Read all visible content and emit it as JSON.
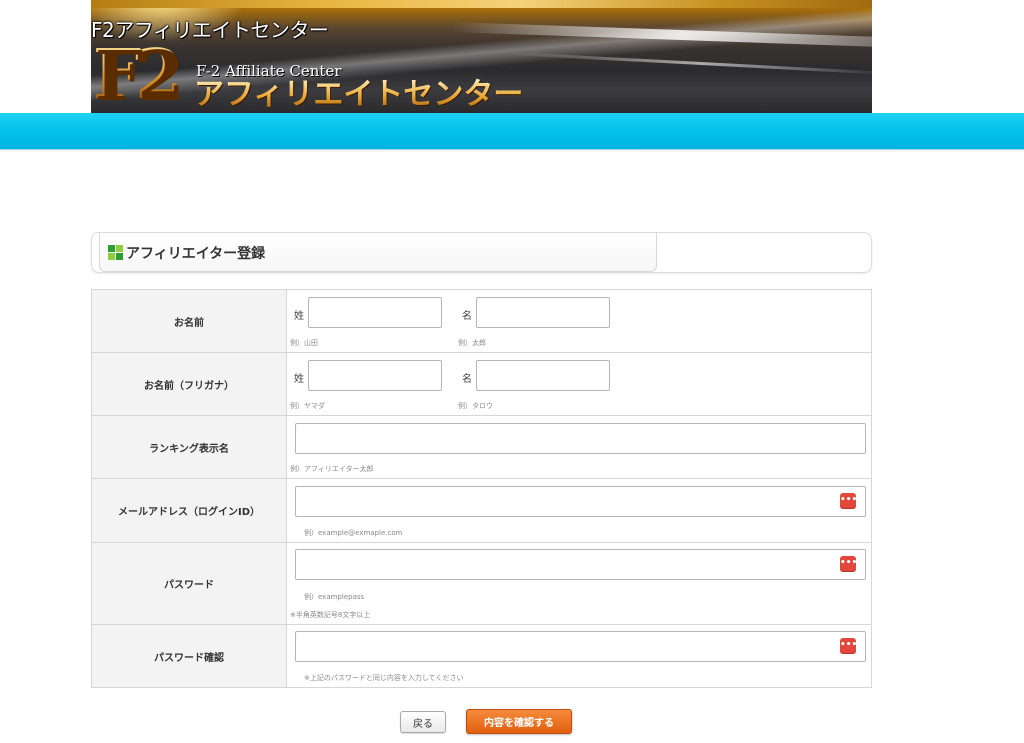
{
  "banner": {
    "top_title": "F2アフィリエイトセンター",
    "logo_mark": "F2",
    "subtitle_en": "F-2 Affiliate Center",
    "title_jp": "アフィリエイトセンター"
  },
  "section": {
    "title": "アフィリエイター登録"
  },
  "form": {
    "name": {
      "label": "お名前",
      "last_label": "姓",
      "first_label": "名",
      "last_hint": "例）山田",
      "first_hint": "例）太郎",
      "last_value": "",
      "first_value": ""
    },
    "kana": {
      "label": "お名前（フリガナ）",
      "last_label": "姓",
      "first_label": "名",
      "last_hint": "例）ヤマダ",
      "first_hint": "例）タロウ",
      "last_value": "",
      "first_value": ""
    },
    "ranking": {
      "label": "ランキング表示名",
      "hint": "例）アフィリエイター太郎",
      "value": ""
    },
    "email": {
      "label": "メールアドレス（ログインID）",
      "hint": "例）example@exmaple.com",
      "value": ""
    },
    "password": {
      "label": "パスワード",
      "hint": "例）examplepass",
      "note": "※半角英数記号8文字以上",
      "value": ""
    },
    "password_confirm": {
      "label": "パスワード確認",
      "note": "※上記のパスワードと同じ内容を入力してください",
      "value": ""
    },
    "badge_glyph": "•••"
  },
  "buttons": {
    "back": "戻る",
    "confirm": "内容を確認する"
  },
  "colors": {
    "navbar": "#04c2ec",
    "confirm_button": "#e9681a",
    "password_badge": "#e3463b",
    "icon_green_dark": "#2e9e2e",
    "icon_green_light": "#8ccf3a"
  }
}
